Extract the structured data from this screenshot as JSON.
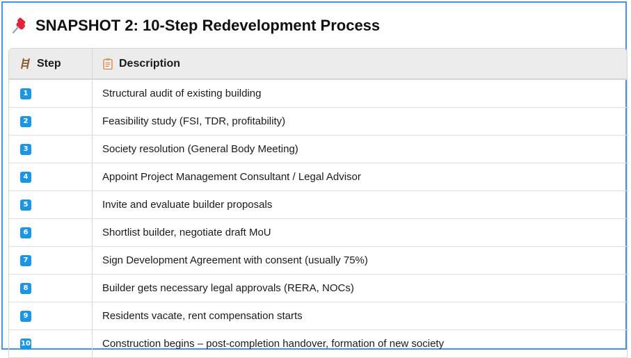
{
  "title": "SNAPSHOT 2: 10-Step Redevelopment Process",
  "title_icon": "pushpin-icon",
  "accent_color": "#1a96e6",
  "frame_color": "#4a90e2",
  "header": {
    "step_label": "Step",
    "step_icon": "ladder-icon",
    "description_label": "Description",
    "description_icon": "clipboard-icon"
  },
  "steps": [
    {
      "number": "1",
      "description": "Structural audit of existing building"
    },
    {
      "number": "2",
      "description": "Feasibility study (FSI, TDR, profitability)"
    },
    {
      "number": "3",
      "description": "Society resolution (General Body Meeting)"
    },
    {
      "number": "4",
      "description": "Appoint Project Management Consultant / Legal Advisor"
    },
    {
      "number": "5",
      "description": "Invite and evaluate builder proposals"
    },
    {
      "number": "6",
      "description": "Shortlist builder, negotiate draft MoU"
    },
    {
      "number": "7",
      "description": "Sign Development Agreement with consent (usually 75%)"
    },
    {
      "number": "8",
      "description": "Builder gets necessary legal approvals (RERA, NOCs)"
    },
    {
      "number": "9",
      "description": "Residents vacate, rent compensation starts"
    },
    {
      "number": "10",
      "description": "Construction begins – post-completion handover, formation of new society"
    }
  ]
}
